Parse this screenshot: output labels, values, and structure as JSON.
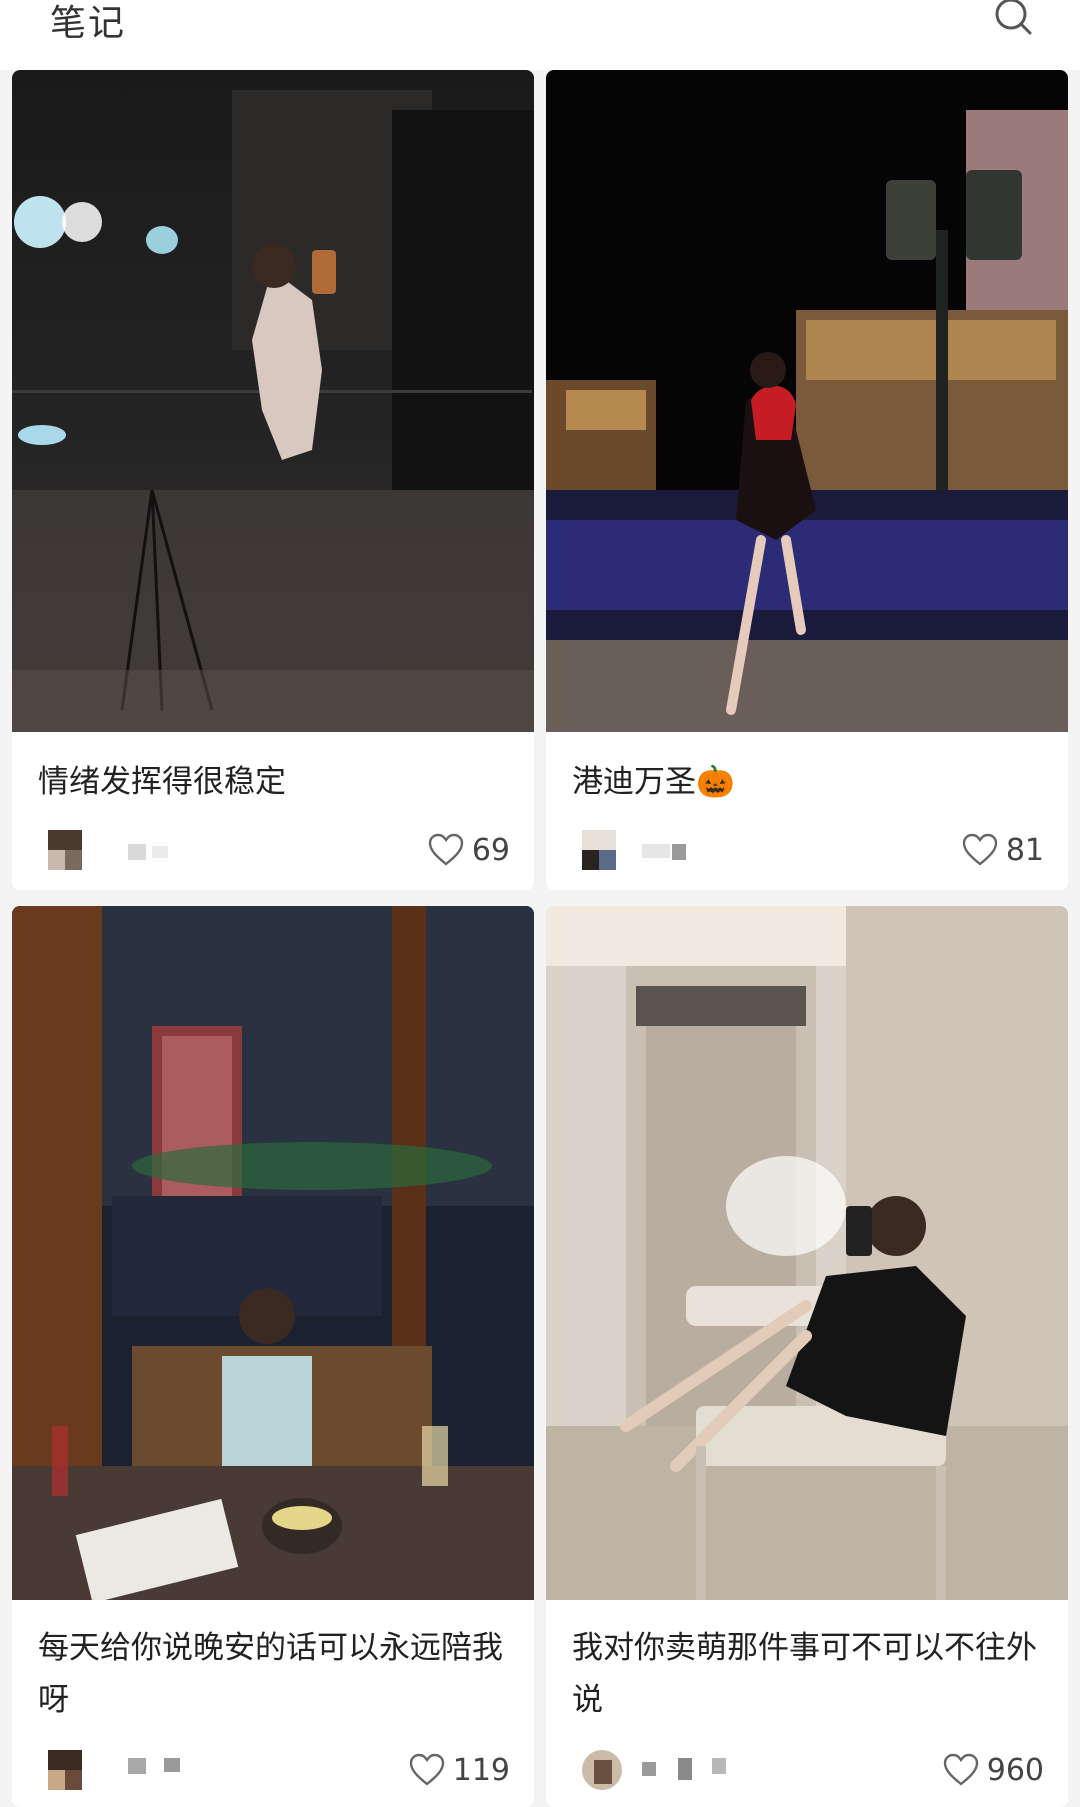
{
  "header": {
    "title": "笔记",
    "search_icon": "search-icon"
  },
  "notes": [
    {
      "caption": "情绪发挥得很稳定",
      "likes": "69",
      "like_icon": "heart-outline-icon"
    },
    {
      "caption": "港迪万圣🎃",
      "likes": "81",
      "like_icon": "heart-outline-icon"
    },
    {
      "caption": "每天给你说晚安的话可以永远陪我呀",
      "likes": "119",
      "like_icon": "heart-outline-icon"
    },
    {
      "caption": "我对你卖萌那件事可不可以不往外说",
      "likes": "960",
      "like_icon": "heart-outline-icon"
    }
  ],
  "colors": {
    "background": "#f4f4f4",
    "card": "#ffffff",
    "text": "#222222",
    "meta": "#444444"
  }
}
